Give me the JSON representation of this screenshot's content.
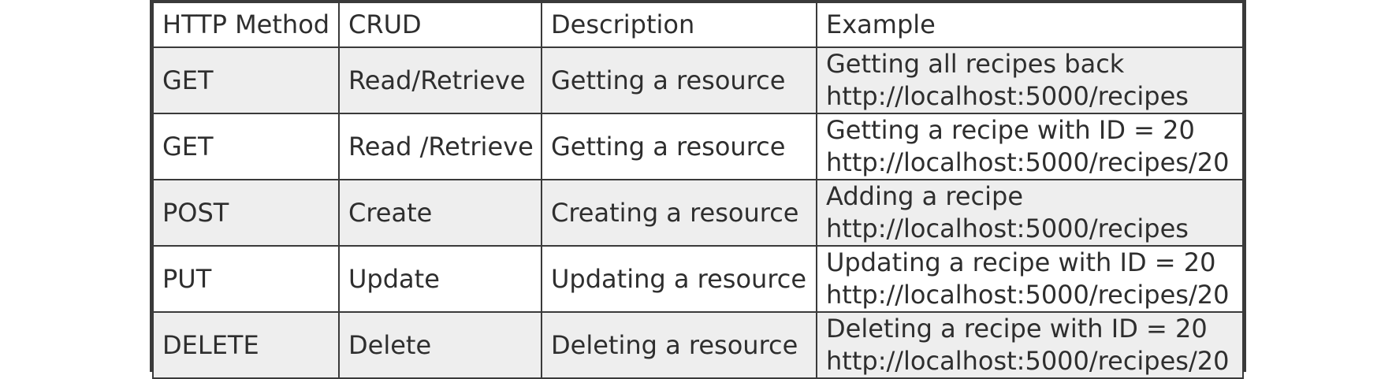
{
  "table": {
    "headers": [
      "HTTP Method",
      "CRUD",
      "Description",
      "Example"
    ],
    "rows": [
      {
        "method": "GET",
        "crud": "Read/Retrieve",
        "description": "Getting a resource",
        "example_text": "Getting all recipes back",
        "example_url": "http://localhost:5000/recipes"
      },
      {
        "method": "GET",
        "crud": "Read /Retrieve",
        "description": "Getting a resource",
        "example_text": "Getting a recipe with ID = 20",
        "example_url": "http://localhost:5000/recipes/20"
      },
      {
        "method": "POST",
        "crud": "Create",
        "description": "Creating a resource",
        "example_text": "Adding a recipe",
        "example_url": "http://localhost:5000/recipes"
      },
      {
        "method": "PUT",
        "crud": "Update",
        "description": "Updating a resource",
        "example_text": "Updating a recipe with ID = 20",
        "example_url": "http://localhost:5000/recipes/20"
      },
      {
        "method": "DELETE",
        "crud": "Delete",
        "description": "Deleting a resource",
        "example_text": "Deleting a recipe with ID = 20",
        "example_url": "http://localhost:5000/recipes/20"
      }
    ]
  },
  "colors": {
    "border": "#3a3a3a",
    "shaded_row": "#eeeeee",
    "plain_row": "#ffffff",
    "text": "#2e2e2e"
  }
}
